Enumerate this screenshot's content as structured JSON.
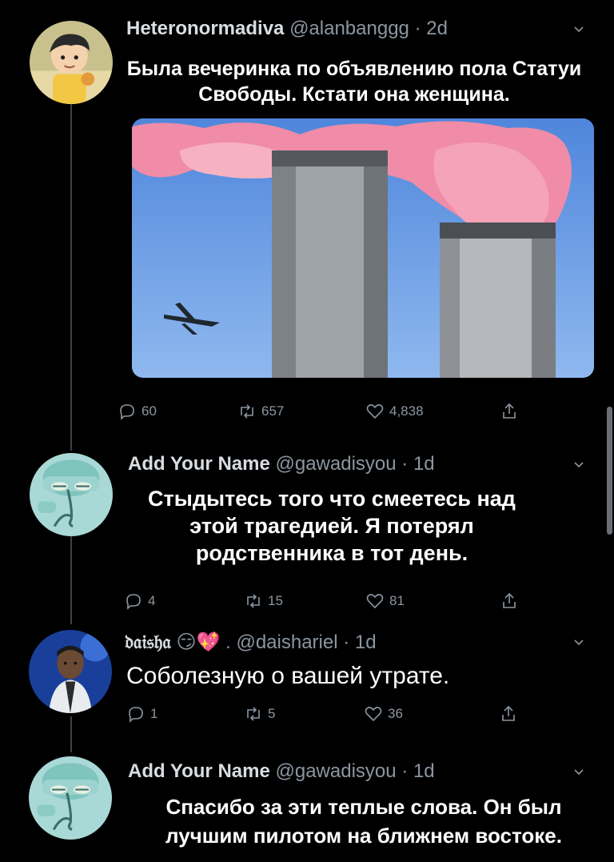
{
  "tweets": [
    {
      "display_name": "Heteronormadiva",
      "handle": "@alanbanggg",
      "time": "2d",
      "text_line1": "Была вечеринка по объявлению пола Статуи",
      "text_line2": "Свободы. Кстати она женщина.",
      "replies": "60",
      "retweets": "657",
      "likes": "4,838"
    },
    {
      "display_name": "Add Your Name",
      "handle": "@gawadisyou",
      "time": "1d",
      "text_line1": "Стыдытесь того что смеетесь над",
      "text_line2": "этой трагедией. Я потерял",
      "text_line3": "родственника в тот день.",
      "replies": "4",
      "retweets": "15",
      "likes": "81"
    },
    {
      "display_name": "𝔡𝔞𝔦𝔰𝔥𝔞",
      "name_emojis": "😏💖 .",
      "handle": "@daishariel",
      "time": "1d",
      "text_line1": "Соболезную о вашей утрате.",
      "replies": "1",
      "retweets": "5",
      "likes": "36"
    },
    {
      "display_name": "Add Your Name",
      "handle": "@gawadisyou",
      "time": "1d",
      "text_line1": "Спасибо за эти теплые слова. Он был",
      "text_line2": "лучшим пилотом на ближнем востоке."
    }
  ],
  "separator": "·",
  "icons": [
    "reply-icon",
    "retweet-icon",
    "like-icon",
    "share-icon",
    "chevron-down-icon"
  ],
  "colors": {
    "background": "#000000",
    "muted": "#8b96a1",
    "text": "#ffffff"
  }
}
